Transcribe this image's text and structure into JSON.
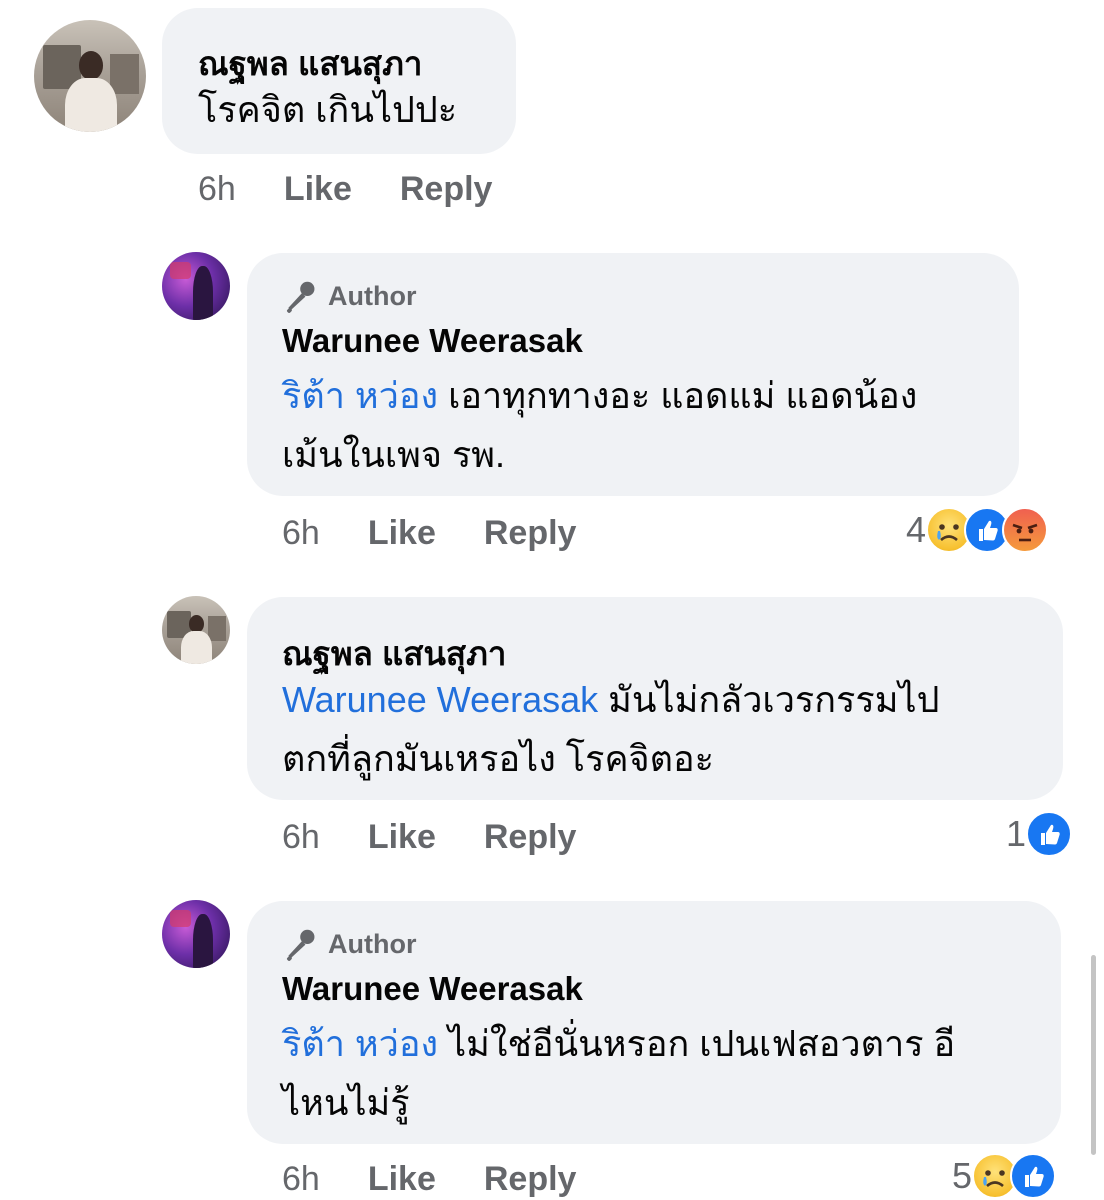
{
  "comments": [
    {
      "author": "ณฐพล แสนสุภา",
      "is_author": false,
      "mention": "",
      "lines": [
        "โรคจิต เกินไปปะ"
      ],
      "time": "6h",
      "like_label": "Like",
      "reply_label": "Reply",
      "reaction_count": "",
      "reactions": []
    },
    {
      "author": "Warunee Weerasak",
      "is_author": true,
      "author_badge": "Author",
      "mention": "ริต้า หว่อง",
      "lines": [
        " เอาทุกทางอะ แอดแม่ แอดน้อง",
        "เม้นในเพจ รพ."
      ],
      "time": "6h",
      "like_label": "Like",
      "reply_label": "Reply",
      "reaction_count": "4",
      "reactions": [
        "sad-icon",
        "like-icon",
        "angry-icon"
      ]
    },
    {
      "author": "ณฐพล แสนสุภา",
      "is_author": false,
      "mention": "Warunee Weerasak",
      "lines": [
        " มันไม่กลัวเวรกรรมไป",
        "ตกที่ลูกมันเหรอไง โรคจิตอะ"
      ],
      "time": "6h",
      "like_label": "Like",
      "reply_label": "Reply",
      "reaction_count": "1",
      "reactions": [
        "like-icon"
      ]
    },
    {
      "author": "Warunee Weerasak",
      "is_author": true,
      "author_badge": "Author",
      "mention": "ริต้า หว่อง",
      "lines": [
        " ไม่ใช่อีนั่นหรอก เปนเฟสอวตาร อี",
        "ไหนไม่รู้"
      ],
      "time": "6h",
      "like_label": "Like",
      "reply_label": "Reply",
      "reaction_count": "5",
      "reactions": [
        "sad-icon",
        "like-icon"
      ]
    }
  ],
  "colors": {
    "bubble": "#f0f2f5",
    "mention": "#216fdb",
    "meta": "#65676b",
    "like_reaction": "#1877f2"
  }
}
